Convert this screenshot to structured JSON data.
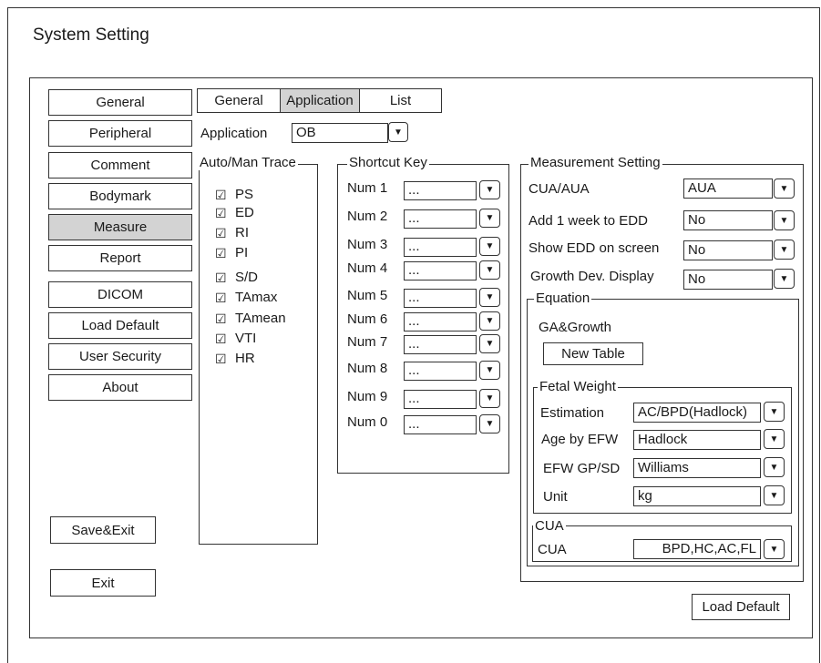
{
  "window": {
    "title": "System Setting"
  },
  "sidebar": {
    "items": [
      {
        "label": "General"
      },
      {
        "label": "Peripheral"
      },
      {
        "label": "Comment"
      },
      {
        "label": "Bodymark"
      },
      {
        "label": "Measure"
      },
      {
        "label": "Report"
      },
      {
        "label": "DICOM"
      },
      {
        "label": "Load Default"
      },
      {
        "label": "User Security"
      },
      {
        "label": "About"
      }
    ],
    "active_index": 4,
    "save_exit_label": "Save&Exit",
    "exit_label": "Exit"
  },
  "tabs": {
    "items": [
      {
        "label": "General"
      },
      {
        "label": "Application"
      },
      {
        "label": "List"
      }
    ],
    "active_index": 1
  },
  "application": {
    "label": "Application",
    "value": "OB"
  },
  "auto_trace": {
    "legend": "Auto/Man Trace",
    "items": [
      {
        "label": "PS",
        "checked": true
      },
      {
        "label": "ED",
        "checked": true
      },
      {
        "label": "RI",
        "checked": true
      },
      {
        "label": "PI",
        "checked": true
      },
      {
        "label": "S/D",
        "checked": true
      },
      {
        "label": "TAmax",
        "checked": true
      },
      {
        "label": "TAmean",
        "checked": true
      },
      {
        "label": "VTI",
        "checked": true
      },
      {
        "label": "HR",
        "checked": true
      }
    ]
  },
  "shortcut": {
    "legend": "Shortcut Key",
    "items": [
      {
        "label": "Num 1",
        "value": "..."
      },
      {
        "label": "Num 2",
        "value": "..."
      },
      {
        "label": "Num 3",
        "value": "..."
      },
      {
        "label": "Num 4",
        "value": "..."
      },
      {
        "label": "Num 5",
        "value": "..."
      },
      {
        "label": "Num 6",
        "value": "..."
      },
      {
        "label": "Num 7",
        "value": "..."
      },
      {
        "label": "Num 8",
        "value": "..."
      },
      {
        "label": "Num 9",
        "value": "..."
      },
      {
        "label": "Num 0",
        "value": "..."
      }
    ]
  },
  "measurement": {
    "legend": "Measurement Setting",
    "cua_aua": {
      "label": "CUA/AUA",
      "value": "AUA"
    },
    "add_week": {
      "label": "Add 1 week to EDD",
      "value": "No"
    },
    "show_edd": {
      "label": "Show EDD on screen",
      "value": "No"
    },
    "growth_dev": {
      "label": "Growth Dev. Display",
      "value": "No"
    },
    "equation": {
      "legend": "Equation",
      "ga_growth_label": "GA&Growth",
      "new_table_label": "New Table",
      "fetal_weight": {
        "legend": "Fetal Weight",
        "estimation": {
          "label": "Estimation",
          "value": "AC/BPD(Hadlock)"
        },
        "age_by_efw": {
          "label": "Age by EFW",
          "value": "Hadlock"
        },
        "efw_gp_sd": {
          "label": "EFW GP/SD",
          "value": "Williams"
        },
        "unit": {
          "label": "Unit",
          "value": "kg"
        }
      },
      "cua": {
        "legend": "CUA",
        "label": "CUA",
        "value": "BPD,HC,AC,FL"
      }
    },
    "load_default_label": "Load Default"
  },
  "icons": {
    "dropdown": "dropdown-arrow-icon",
    "checkbox": "checkbox-checked-icon"
  },
  "colors": {
    "active_bg": "#d3d3d3",
    "border": "#333333"
  }
}
